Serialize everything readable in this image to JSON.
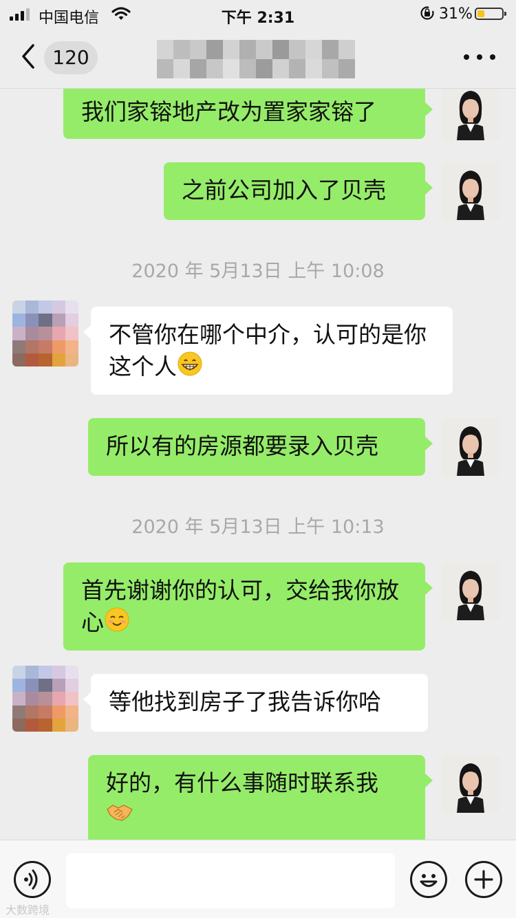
{
  "status_bar": {
    "carrier": "中国电信",
    "time": "下午 2:31",
    "battery_percent": "31%",
    "battery_level": 0.31,
    "icons": [
      "signal-icon",
      "wifi-icon",
      "rotation-lock-icon",
      "battery-icon"
    ]
  },
  "nav": {
    "back_icon": "chevron-left-icon",
    "unread_count": "120",
    "title": "",
    "title_blurred": true,
    "more_icon": "ellipsis-icon"
  },
  "messages": [
    {
      "side": "out",
      "text": "我们家镕地产改为置家家镕了"
    },
    {
      "side": "out",
      "text": "之前公司加入了贝壳"
    },
    {
      "type": "time",
      "text": "2020 年 5月13日 上午 10:08"
    },
    {
      "side": "in",
      "text": "不管你在哪个中介，认可的是你这个人",
      "emoji": "grinning-face-icon"
    },
    {
      "side": "out",
      "text": "所以有的房源都要录入贝壳"
    },
    {
      "type": "time",
      "text": "2020 年 5月13日 上午 10:13"
    },
    {
      "side": "out",
      "text": "首先谢谢你的认可，交给我你放心",
      "emoji": "smiling-blush-face-icon"
    },
    {
      "side": "in",
      "text": "等他找到房子了我告诉你哈"
    },
    {
      "side": "out",
      "text": "好的，有什么事随时联系我",
      "emoji": "handshake-icon"
    }
  ],
  "input_bar": {
    "voice_icon": "voice-icon",
    "input_value": "",
    "emoji_icon": "emoji-icon",
    "plus_icon": "plus-icon"
  },
  "watermark": "大数跨境",
  "colors": {
    "background": "#ededed",
    "outgoing_bubble": "#95ec69",
    "incoming_bubble": "#ffffff",
    "timestamp_text": "#a8a8a8",
    "battery_fill": "#f5c518"
  }
}
